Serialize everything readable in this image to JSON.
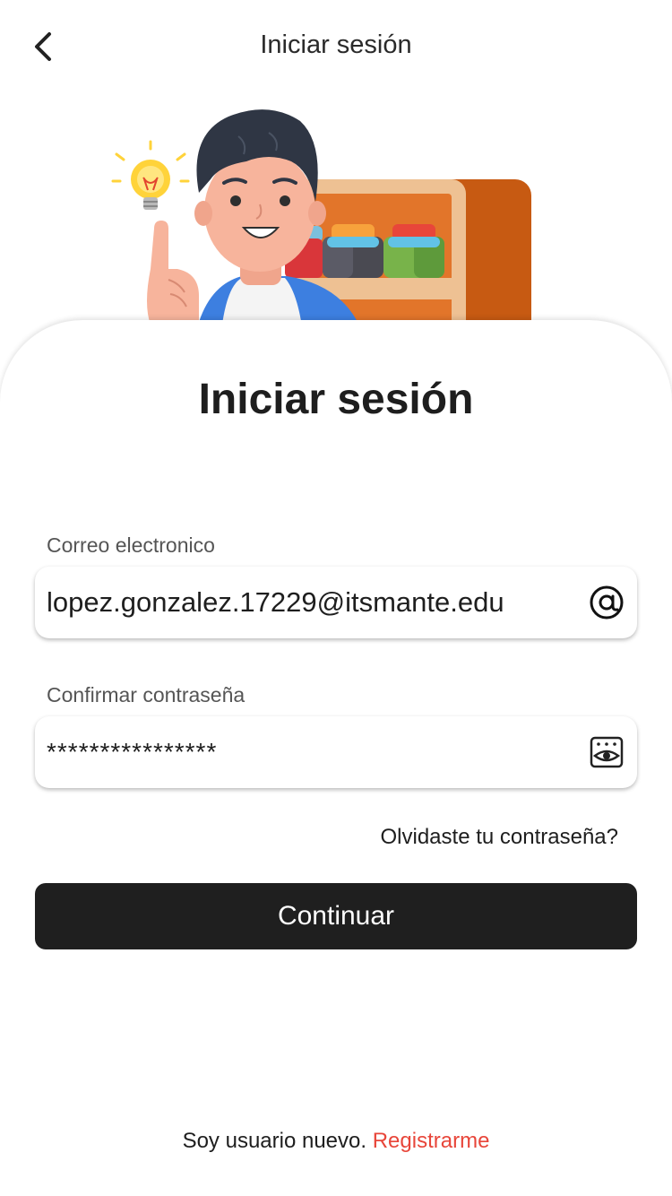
{
  "nav": {
    "title": "Iniciar sesión",
    "back_icon": "chevron-left-icon"
  },
  "hero": {
    "illustration": "person-with-idea-and-shelf"
  },
  "form": {
    "heading": "Iniciar sesión",
    "email": {
      "label": "Correo electronico",
      "value": "lopez.gonzalez.17229@itsmante.edu",
      "icon": "at-sign-icon"
    },
    "password": {
      "label": "Confirmar contraseña",
      "value": "****************",
      "icon": "eye-icon"
    },
    "forgot_label": "Olvidaste tu contraseña?",
    "submit_label": "Continuar"
  },
  "footer": {
    "prompt": "Soy usuario nuevo.",
    "register_label": "Registrarme"
  },
  "colors": {
    "primary_button": "#1f1f1f",
    "link_accent": "#e8463a",
    "shelf_orange": "#e2752a"
  }
}
